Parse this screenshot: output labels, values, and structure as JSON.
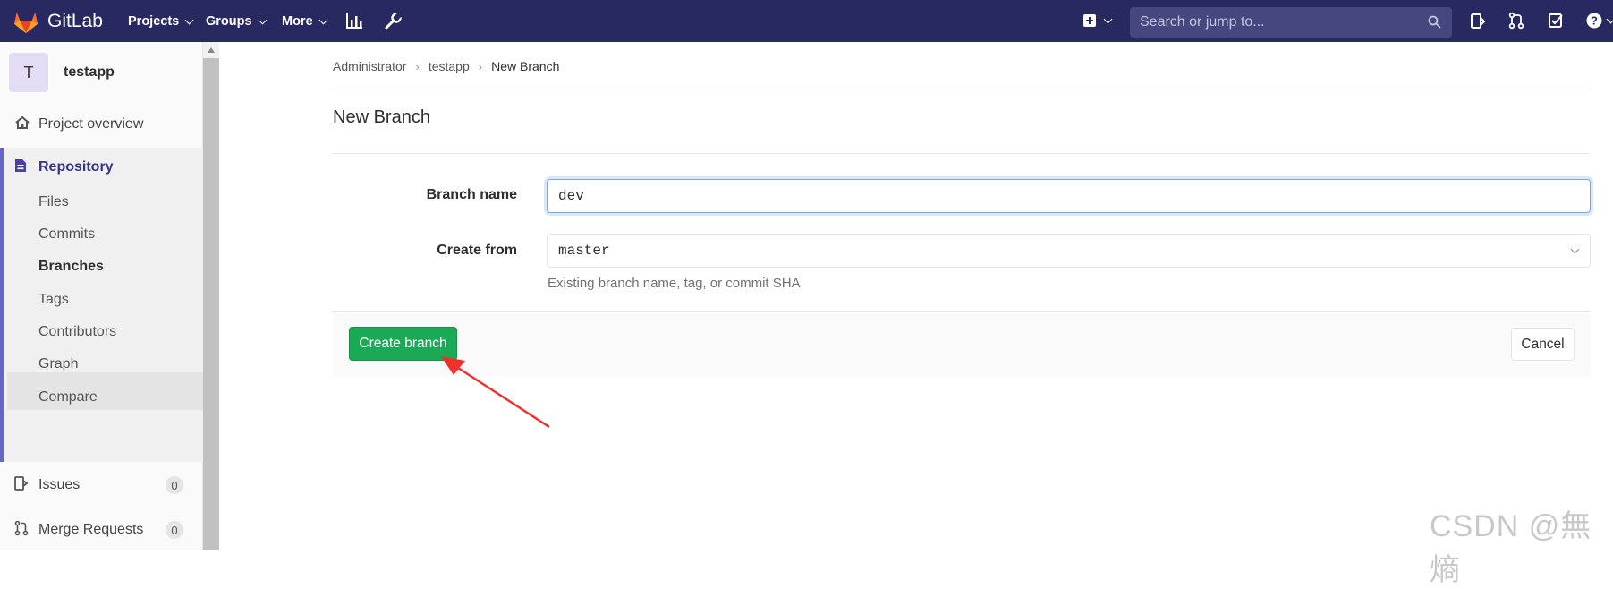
{
  "navbar": {
    "brand": "GitLab",
    "menus": [
      "Projects",
      "Groups",
      "More"
    ],
    "search_placeholder": "Search or jump to...",
    "icons": [
      "activity-chart-icon",
      "wrench-icon",
      "plus-square-icon",
      "issues-icon",
      "merge-request-icon",
      "todo-check-icon",
      "help-icon"
    ]
  },
  "sidebar": {
    "avatar_letter": "T",
    "project_name": "testapp",
    "overview": "Project overview",
    "repository": "Repository",
    "repo_items": [
      "Files",
      "Commits",
      "Branches",
      "Tags",
      "Contributors",
      "Graph",
      "Compare"
    ],
    "active_item": "Branches",
    "issues": "Issues",
    "issues_count": "0",
    "merge_requests": "Merge Requests",
    "merge_requests_count": "0"
  },
  "breadcrumb": [
    "Administrator",
    "testapp",
    "New Branch"
  ],
  "page_title": "New Branch",
  "form": {
    "branch_name_label": "Branch name",
    "branch_name_value": "dev",
    "create_from_label": "Create from",
    "create_from_value": "master",
    "help_text": "Existing branch name, tag, or commit SHA"
  },
  "buttons": {
    "create": "Create branch",
    "cancel": "Cancel"
  },
  "watermark": "CSDN @無熵",
  "colors": {
    "navbar": "#292961",
    "accent": "#6666c4",
    "create_button": "#1aaa55",
    "annotation_arrow": "#f0302a"
  }
}
